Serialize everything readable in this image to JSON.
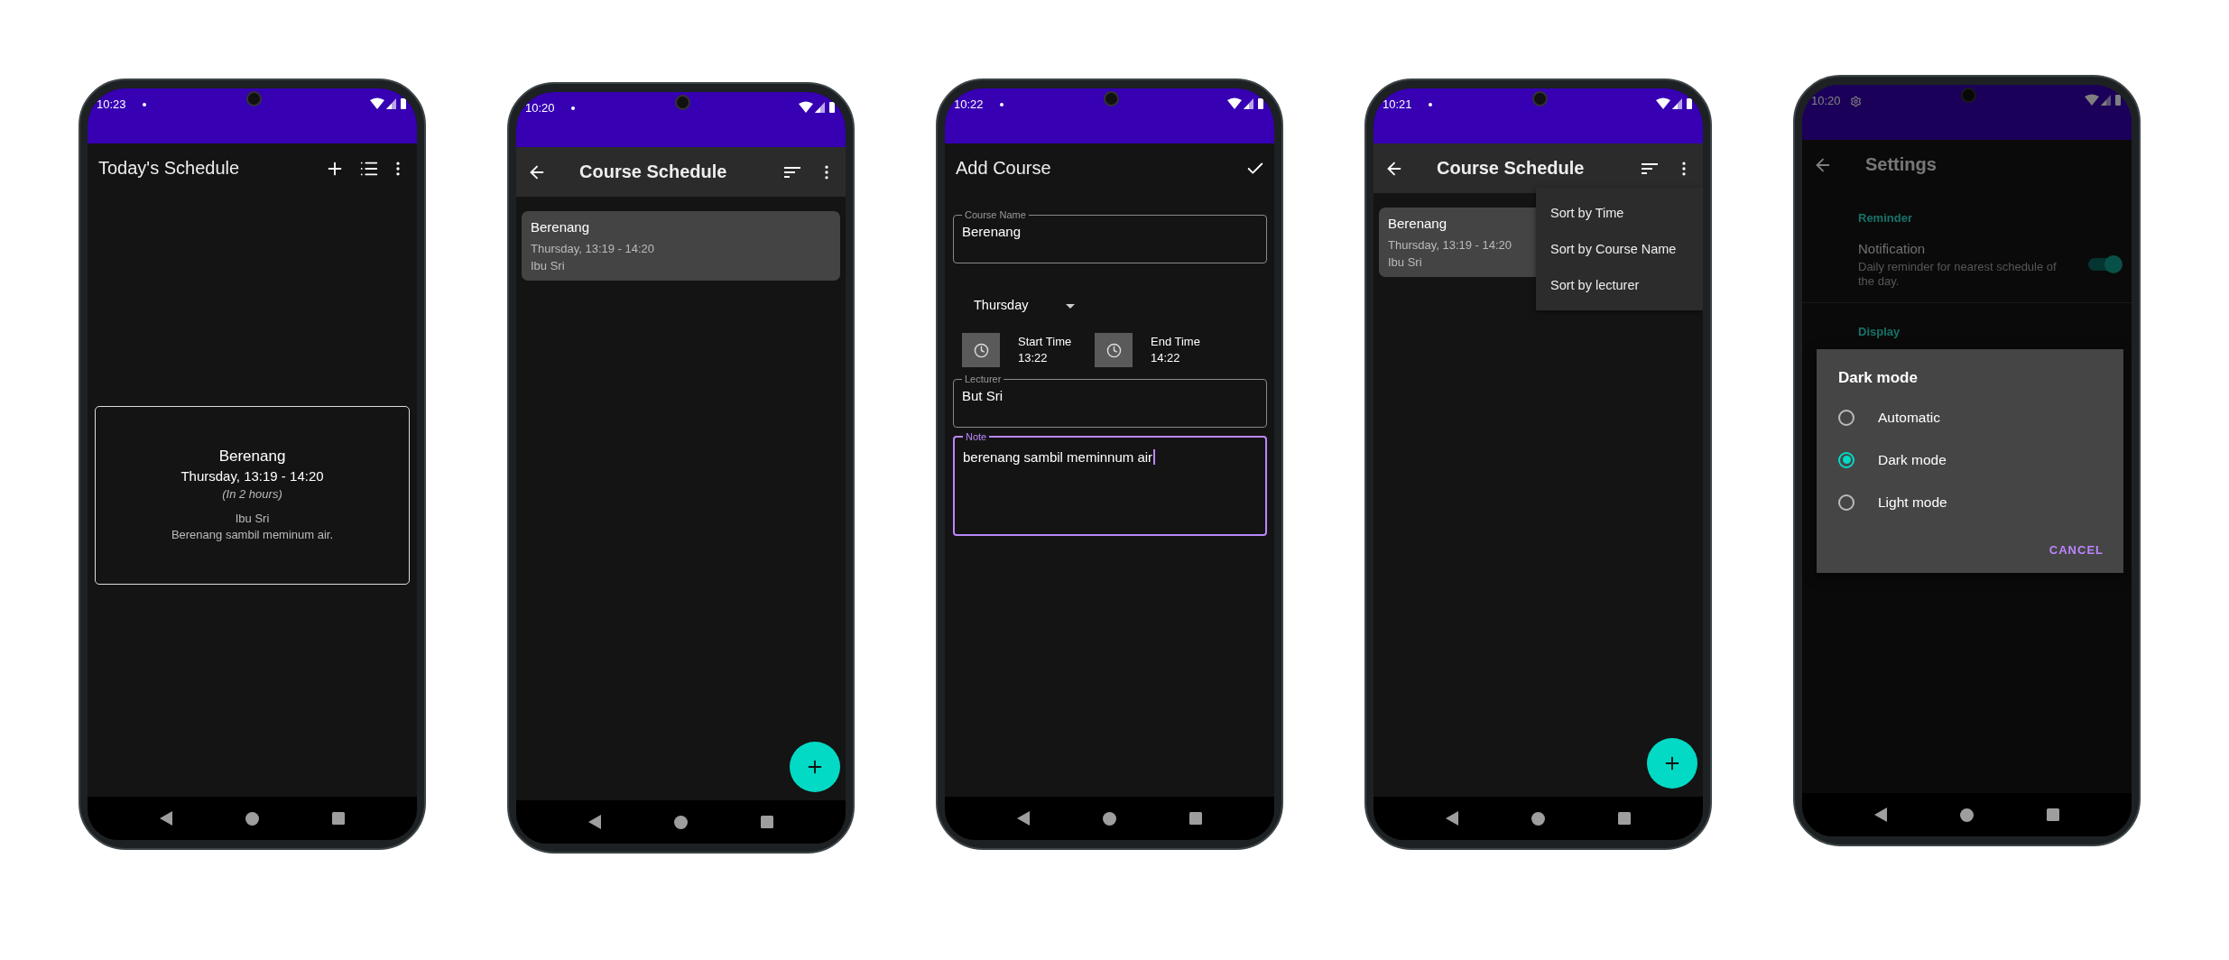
{
  "screens": [
    {
      "kind": "today",
      "status": {
        "time": "10:23",
        "notification_dot": true
      },
      "app_bar": {
        "title": "Today's Schedule",
        "has_back": false,
        "actions": [
          {
            "kind": "add"
          },
          {
            "kind": "list"
          },
          {
            "kind": "more"
          }
        ]
      },
      "card": {
        "course": "Berenang",
        "time": "Thursday, 13:19 - 14:20",
        "remaining": "(In 2 hours)",
        "lecturer": "Ibu Sri",
        "note": "Berenang sambil meminum air."
      }
    },
    {
      "kind": "course_list",
      "status": {
        "time": "10:20",
        "notification_dot": true
      },
      "app_bar": {
        "title": "Course Schedule",
        "has_back": true,
        "elevated": true,
        "actions": [
          {
            "kind": "sort"
          },
          {
            "kind": "more"
          }
        ]
      },
      "courses": [
        {
          "name": "Berenang",
          "time": "Thursday, 13:19 - 14:20",
          "lecturer": "Ibu Sri"
        }
      ],
      "fab": true
    },
    {
      "kind": "add_course",
      "status": {
        "time": "10:22",
        "notification_dot": true
      },
      "app_bar": {
        "title": "Add Course",
        "has_back": false,
        "actions": [
          {
            "kind": "check"
          }
        ]
      },
      "fields": [
        {
          "kind": "text",
          "label": "Course Name",
          "value": "Berenang",
          "focused": false
        },
        {
          "kind": "dropdown",
          "value": "Thursday"
        },
        {
          "kind": "times",
          "items": [
            {
              "label": "Start Time",
              "value": "13:22"
            },
            {
              "label": "End Time",
              "value": "14:22"
            }
          ]
        },
        {
          "kind": "text",
          "label": "Lecturer",
          "value": "But Sri",
          "focused": false
        },
        {
          "kind": "multiline",
          "label": "Note",
          "value": "berenang sambil meminnum air",
          "focused": true
        }
      ]
    },
    {
      "kind": "course_list",
      "status": {
        "time": "10:21",
        "notification_dot": true
      },
      "app_bar": {
        "title": "Course Schedule",
        "has_back": true,
        "elevated": true,
        "actions": [
          {
            "kind": "sort"
          },
          {
            "kind": "more"
          }
        ]
      },
      "courses": [
        {
          "name": "Berenang",
          "time": "Thursday, 13:19 - 14:20",
          "lecturer": "Ibu Sri"
        }
      ],
      "fab": true,
      "menu": {
        "items": [
          "Sort by Time",
          "Sort by Course Name",
          "Sort by lecturer"
        ]
      }
    },
    {
      "kind": "settings",
      "status": {
        "time": "10:20",
        "settings_icon": true
      },
      "app_bar": {
        "title": "Settings",
        "has_back": true
      },
      "dimmed": true,
      "sections": [
        {
          "header": "Reminder",
          "items": [
            {
              "title": "Notification",
              "summary": "Daily reminder for nearest schedule of the day.",
              "on": true
            }
          ]
        },
        {
          "header": "Display"
        }
      ],
      "dialog": {
        "title": "Dark mode",
        "options": [
          {
            "label": "Automatic",
            "selected": false
          },
          {
            "label": "Dark mode",
            "selected": true
          },
          {
            "label": "Light mode",
            "selected": false
          }
        ],
        "button": "CANCEL"
      }
    }
  ]
}
